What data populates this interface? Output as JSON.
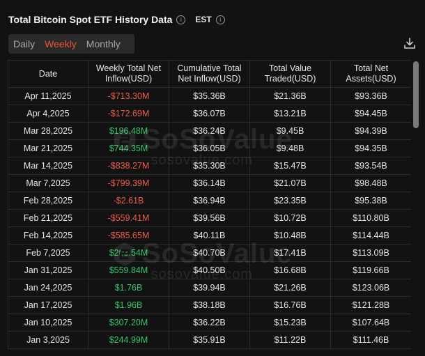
{
  "header": {
    "title": "Total Bitcoin Spot ETF History Data",
    "timezone": "EST"
  },
  "tabs": [
    {
      "label": "Daily",
      "active": false
    },
    {
      "label": "Weekly",
      "active": true
    },
    {
      "label": "Monthly",
      "active": false
    }
  ],
  "watermark": {
    "main": "SoSoValue",
    "sub": "sosovalue.com"
  },
  "table": {
    "headers": [
      "Date",
      "Weekly Total Net Inflow(USD)",
      "Cumulative Total Net Inflow(USD)",
      "Total Value Traded(USD)",
      "Total Net Assets(USD)"
    ],
    "rows": [
      {
        "date": "Apr 11,2025",
        "inflow": "-$713.30M",
        "cumulative": "$35.36B",
        "traded": "$21.36B",
        "assets": "$93.36B"
      },
      {
        "date": "Apr 4,2025",
        "inflow": "-$172.69M",
        "cumulative": "$36.07B",
        "traded": "$13.21B",
        "assets": "$94.45B"
      },
      {
        "date": "Mar 28,2025",
        "inflow": "$196.48M",
        "cumulative": "$36.24B",
        "traded": "$9.45B",
        "assets": "$94.39B"
      },
      {
        "date": "Mar 21,2025",
        "inflow": "$744.35M",
        "cumulative": "$36.05B",
        "traded": "$9.48B",
        "assets": "$94.35B"
      },
      {
        "date": "Mar 14,2025",
        "inflow": "-$838.27M",
        "cumulative": "$35.30B",
        "traded": "$15.47B",
        "assets": "$93.54B"
      },
      {
        "date": "Mar 7,2025",
        "inflow": "-$799.39M",
        "cumulative": "$36.14B",
        "traded": "$21.07B",
        "assets": "$98.48B"
      },
      {
        "date": "Feb 28,2025",
        "inflow": "-$2.61B",
        "cumulative": "$36.94B",
        "traded": "$23.35B",
        "assets": "$95.38B"
      },
      {
        "date": "Feb 21,2025",
        "inflow": "-$559.41M",
        "cumulative": "$39.56B",
        "traded": "$10.72B",
        "assets": "$110.80B"
      },
      {
        "date": "Feb 14,2025",
        "inflow": "-$585.65M",
        "cumulative": "$40.11B",
        "traded": "$10.48B",
        "assets": "$114.44B"
      },
      {
        "date": "Feb 7,2025",
        "inflow": "$203.54M",
        "cumulative": "$40.70B",
        "traded": "$17.41B",
        "assets": "$113.09B"
      },
      {
        "date": "Jan 31,2025",
        "inflow": "$559.84M",
        "cumulative": "$40.50B",
        "traded": "$16.68B",
        "assets": "$119.66B"
      },
      {
        "date": "Jan 24,2025",
        "inflow": "$1.76B",
        "cumulative": "$39.94B",
        "traded": "$21.26B",
        "assets": "$123.06B"
      },
      {
        "date": "Jan 17,2025",
        "inflow": "$1.96B",
        "cumulative": "$38.18B",
        "traded": "$16.76B",
        "assets": "$121.28B"
      },
      {
        "date": "Jan 10,2025",
        "inflow": "$307.20M",
        "cumulative": "$36.22B",
        "traded": "$15.23B",
        "assets": "$107.64B"
      },
      {
        "date": "Jan 3,2025",
        "inflow": "$244.99M",
        "cumulative": "$35.91B",
        "traded": "$11.22B",
        "assets": "$111.46B"
      }
    ]
  },
  "colors": {
    "positive": "#34c56a",
    "negative": "#ef5a4a",
    "accent": "#f0523b"
  },
  "icons": {
    "info": "info-icon",
    "download": "download-icon"
  }
}
